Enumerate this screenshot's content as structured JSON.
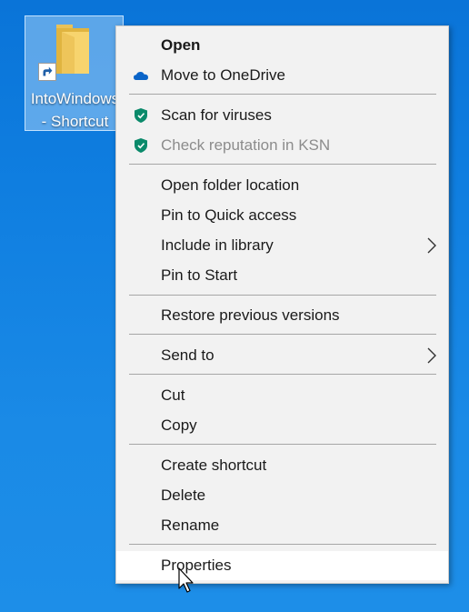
{
  "desktop": {
    "shortcut": {
      "label_line1": "IntoWindows",
      "label_line2": "- Shortcut",
      "icon": "folder-shortcut-icon"
    },
    "background_color": "#0f7ee0"
  },
  "context_menu": {
    "items": [
      {
        "label": "Open",
        "bold": true
      },
      {
        "label": "Move to OneDrive",
        "icon": "onedrive-cloud-icon"
      },
      {
        "label": "Scan for viruses",
        "icon": "kaspersky-shield-icon"
      },
      {
        "label": "Check reputation in KSN",
        "icon": "kaspersky-shield-icon",
        "disabled": true
      },
      {
        "label": "Open folder location"
      },
      {
        "label": "Pin to Quick access"
      },
      {
        "label": "Include in library",
        "submenu": true
      },
      {
        "label": "Pin to Start"
      },
      {
        "label": "Restore previous versions"
      },
      {
        "label": "Send to",
        "submenu": true
      },
      {
        "label": "Cut"
      },
      {
        "label": "Copy"
      },
      {
        "label": "Create shortcut"
      },
      {
        "label": "Delete"
      },
      {
        "label": "Rename"
      },
      {
        "label": "Properties",
        "hovered": true
      }
    ]
  },
  "colors": {
    "menu_bg": "#f2f2f2",
    "hover_bg": "#ffffff",
    "disabled_text": "#8c8c8c",
    "onedrive_blue": "#0a64c8",
    "shield_green": "#0b8a6b"
  }
}
